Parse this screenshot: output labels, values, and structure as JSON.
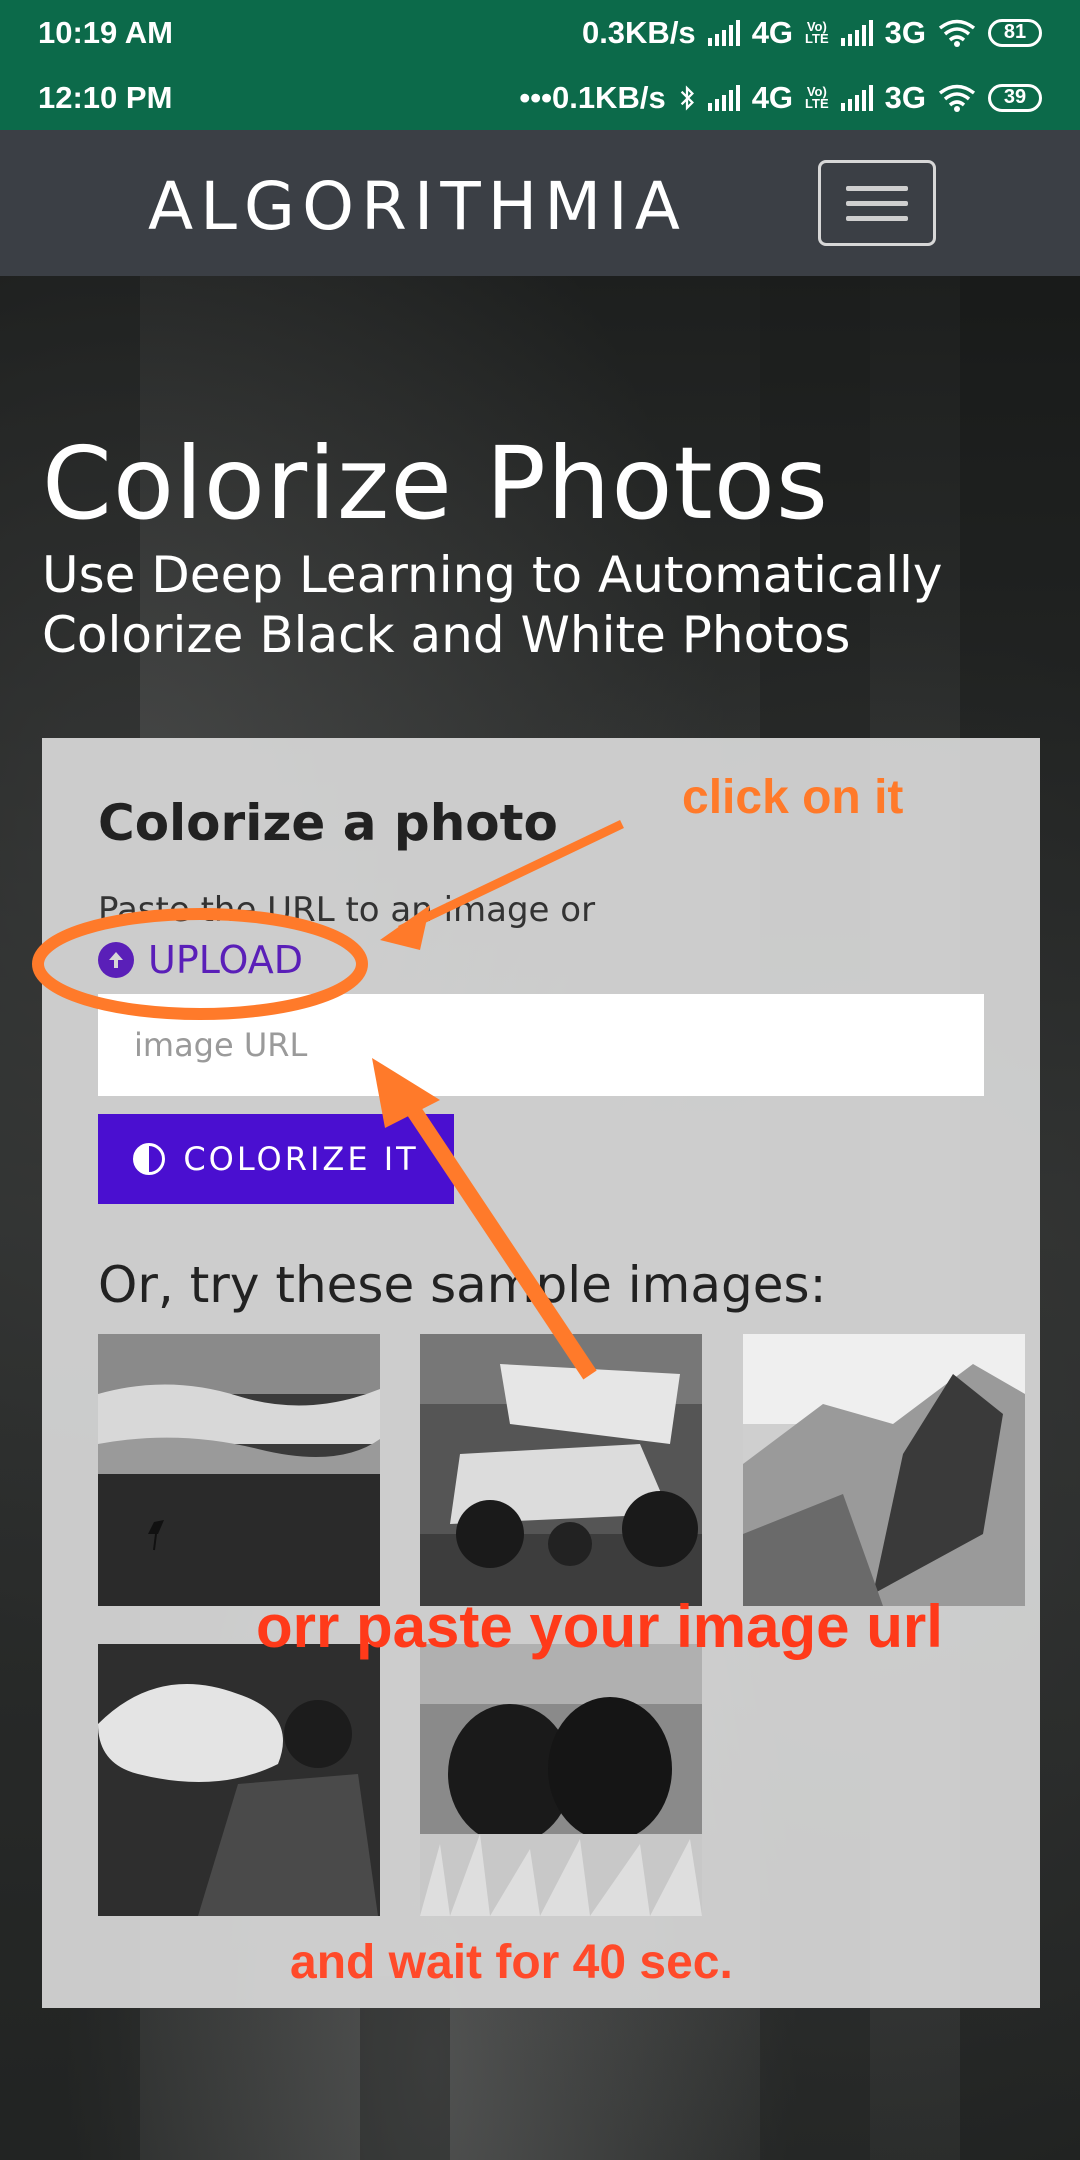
{
  "status_bar_1": {
    "time": "10:19 AM",
    "speed": "0.3KB/s",
    "net1": "4G",
    "volte": "Vo) LTE",
    "net2": "3G",
    "battery": "81"
  },
  "status_bar_2": {
    "time": "12:10 PM",
    "speed": "•••0.1KB/s",
    "net1": "4G",
    "volte": "Vo) LTE",
    "net2": "3G",
    "battery": "39"
  },
  "header": {
    "brand": "ALGORITHMIA"
  },
  "hero": {
    "title": "Colorize Photos",
    "subtitle": "Use Deep Learning to Automatically Colorize Black and White Photos"
  },
  "card": {
    "title": "Colorize a photo",
    "paste_text": "Paste the URL to an image or",
    "upload_label": "UPLOAD",
    "url_placeholder": "image URL",
    "colorize_label": "COLORIZE IT",
    "samples_label": "Or, try these sample images:"
  },
  "annotations": {
    "click": "click on it",
    "paste": "orr paste your image url",
    "wait": "and wait for 40 sec."
  },
  "colors": {
    "status_bar": "#0c6a4a",
    "navbar": "#3b3f45",
    "accent": "#4a0fd0",
    "annotation_orange": "#ff7a2a"
  }
}
